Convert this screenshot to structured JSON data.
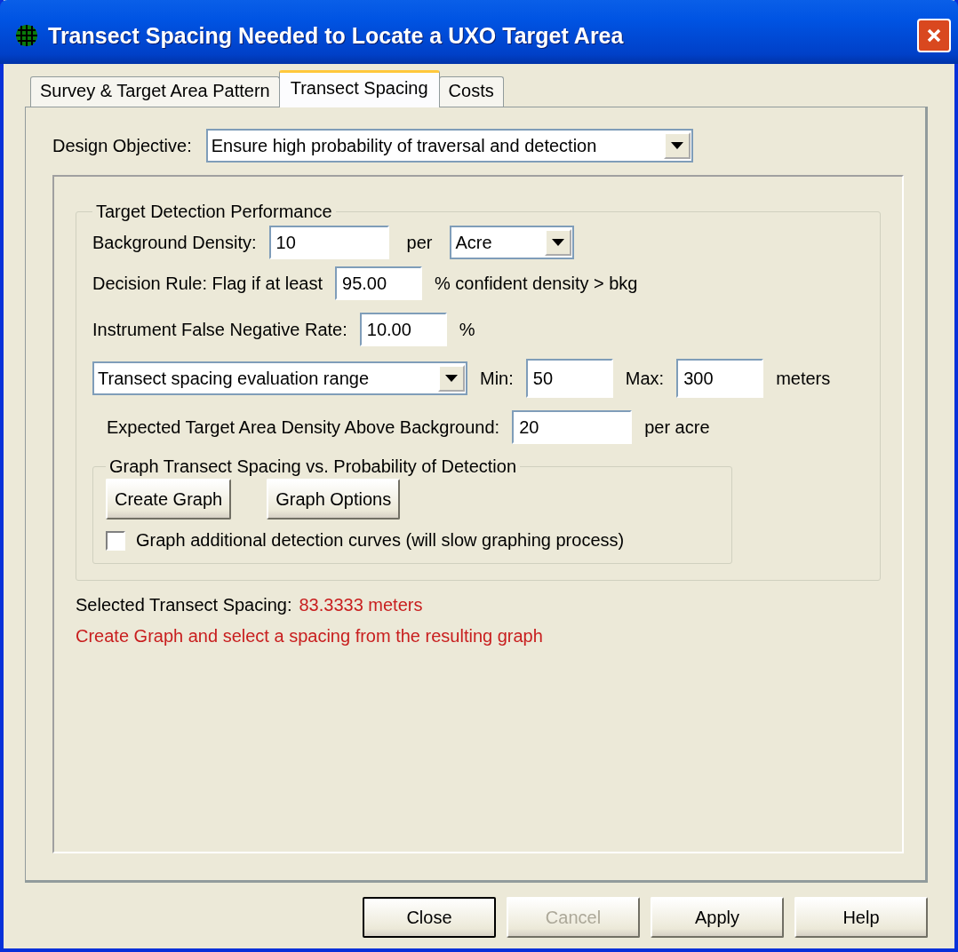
{
  "window": {
    "title": "Transect Spacing Needed to Locate a UXO Target Area"
  },
  "tabs": [
    {
      "label": "Survey & Target Area Pattern",
      "selected": false
    },
    {
      "label": "Transect Spacing",
      "selected": true
    },
    {
      "label": "Costs",
      "selected": false
    }
  ],
  "design_objective": {
    "label": "Design Objective:",
    "value": "Ensure high probability of traversal and detection"
  },
  "detection_group": {
    "title": "Target Detection Performance",
    "background_density": {
      "label": "Background Density:",
      "value": "10",
      "per": "per",
      "unit": "Acre"
    },
    "decision_rule": {
      "label": "Decision Rule:  Flag if at least",
      "value": "95.00",
      "suffix": "% confident density > bkg"
    },
    "false_negative": {
      "label": "Instrument False Negative Rate:",
      "value": "10.00",
      "suffix": "%"
    },
    "range": {
      "mode": "Transect spacing evaluation range",
      "min_label": "Min:",
      "min": "50",
      "max_label": "Max:",
      "max": "300",
      "unit": "meters"
    },
    "expected_density": {
      "label": "Expected Target Area Density Above Background:",
      "value": "20",
      "unit": "per acre"
    },
    "graph_group": {
      "title": "Graph Transect Spacing vs. Probability of Detection",
      "buttons": [
        "Create Graph",
        "Graph Options"
      ],
      "additional_curves": {
        "label": "Graph additional detection curves (will slow graphing process)",
        "checked": false
      }
    }
  },
  "selected_spacing": {
    "label": "Selected Transect Spacing:",
    "value": "83.3333 meters"
  },
  "message": "Create Graph and select a spacing from the resulting graph",
  "buttons": [
    {
      "label": "Close",
      "default": true,
      "disabled": false
    },
    {
      "label": "Cancel",
      "default": false,
      "disabled": true
    },
    {
      "label": "Apply",
      "default": false,
      "disabled": false
    },
    {
      "label": "Help",
      "default": false,
      "disabled": false
    }
  ]
}
